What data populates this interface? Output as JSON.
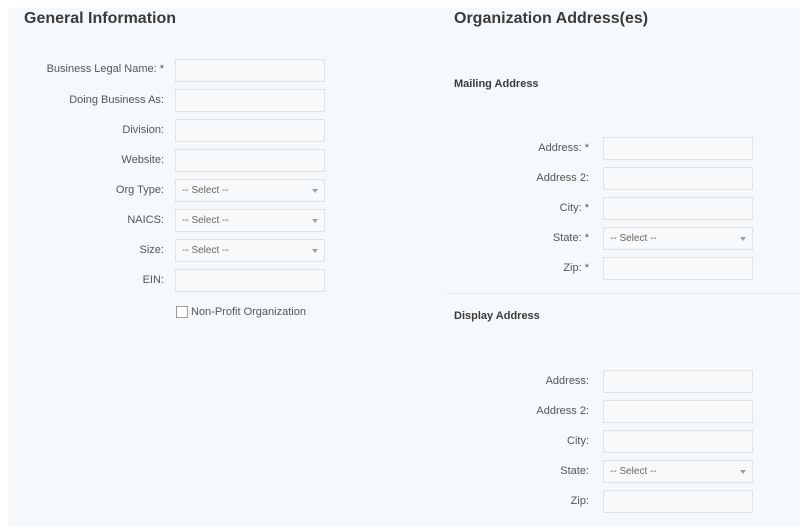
{
  "general": {
    "title": "General Information",
    "business_legal_name_label": "Business Legal Name: *",
    "business_legal_name_value": "",
    "doing_business_as_label": "Doing Business As:",
    "doing_business_as_value": "",
    "division_label": "Division:",
    "division_value": "",
    "website_label": "Website:",
    "website_value": "",
    "org_type_label": "Org Type:",
    "org_type_value": "-- Select --",
    "naics_label": "NAICS:",
    "naics_value": "-- Select --",
    "size_label": "Size:",
    "size_value": "-- Select --",
    "ein_label": "EIN:",
    "ein_value": "",
    "nonprofit_label": "Non-Profit Organization",
    "nonprofit_checked": false
  },
  "addresses": {
    "title": "Organization Address(es)",
    "mailing": {
      "title": "Mailing Address",
      "address_label": "Address: *",
      "address_value": "",
      "address2_label": "Address 2:",
      "address2_value": "",
      "city_label": "City: *",
      "city_value": "",
      "state_label": "State: *",
      "state_value": "-- Select --",
      "zip_label": "Zip: *",
      "zip_value": ""
    },
    "display": {
      "title": "Display Address",
      "address_label": "Address:",
      "address_value": "",
      "address2_label": "Address 2:",
      "address2_value": "",
      "city_label": "City:",
      "city_value": "",
      "state_label": "State:",
      "state_value": "-- Select --",
      "zip_label": "Zip:",
      "zip_value": ""
    }
  },
  "icons": {
    "dropdown": "chevron-down-icon",
    "checkbox": "checkbox-icon"
  },
  "colors": {
    "panel_background": "#f6f9fb",
    "field_border": "#dfe3e6",
    "heading_text": "#3a3a3a",
    "label_text": "#555555"
  }
}
